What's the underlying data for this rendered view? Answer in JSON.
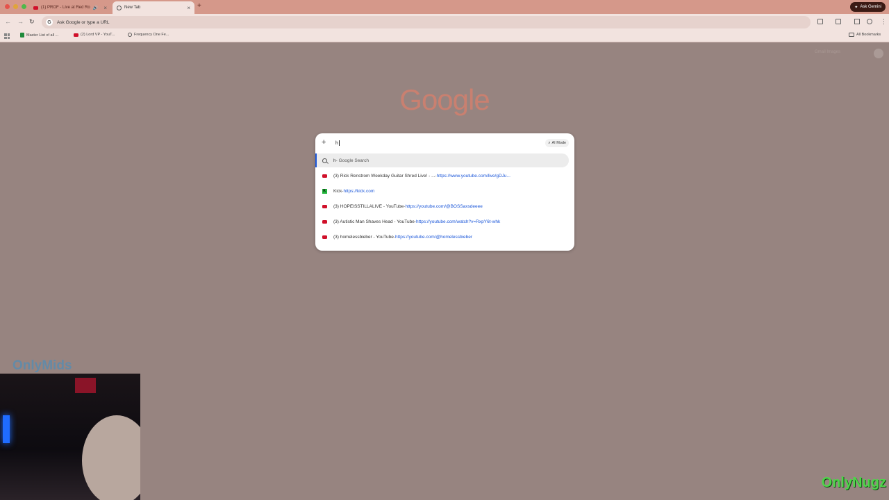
{
  "tabs": [
    {
      "title": "(1) PROF - Live at Red Ro",
      "favicon": "youtube-icon",
      "audio": true
    },
    {
      "title": "New Tab",
      "favicon": "chrome-icon",
      "active": true
    }
  ],
  "gemini_label": "Ask Gemini",
  "omnibox": {
    "placeholder": "Ask Google or type a URL"
  },
  "bookmarks": [
    {
      "label": "Master List of all ...",
      "icon": "sheets-icon"
    },
    {
      "label": "(2) Lord VP - YouT...",
      "icon": "youtube-icon"
    },
    {
      "label": "Frequency One Fe...",
      "icon": "globe-icon"
    }
  ],
  "all_bookmarks_label": "All Bookmarks",
  "ntp": {
    "top_links": "Gmail  Images",
    "logo": "Google"
  },
  "dropdown": {
    "typed": "h",
    "ai_mode_label": "AI Mode",
    "suggestions": [
      {
        "icon": "search-icon",
        "title": "h",
        "suffix": " - Google Search",
        "url": ""
      },
      {
        "icon": "youtube-icon",
        "title": "(3) Rick Renstrom Weekday Guitar Shred Live! - ... ",
        "suffix": "- ",
        "url": "https://www.youtube.com/live/gDJu..."
      },
      {
        "icon": "kick-icon",
        "title": "Kick ",
        "suffix": "- ",
        "url": "https://kick.com"
      },
      {
        "icon": "youtube-icon",
        "title": "(3) HOPEISSTILLALIVE - YouTube ",
        "suffix": "- ",
        "url": "https://youtube.com/@BOSSaxsdeeee"
      },
      {
        "icon": "youtube-icon",
        "title": "(3) Autistic Man Shaves Head - YouTube ",
        "suffix": "- ",
        "url": "https://youtube.com/watch?v=RxpY6t-whk"
      },
      {
        "icon": "youtube-icon",
        "title": "(3) homelessbieber - YouTube ",
        "suffix": "- ",
        "url": "https://youtube.com/@homelessbieber"
      }
    ]
  },
  "overlays": {
    "left_watermark": "OnlyMids",
    "right_watermark": "OnlyNugz"
  },
  "colors": {
    "accent": "#1a56d9",
    "tabstrip": "#d5988a",
    "page_bg": "#978480"
  }
}
